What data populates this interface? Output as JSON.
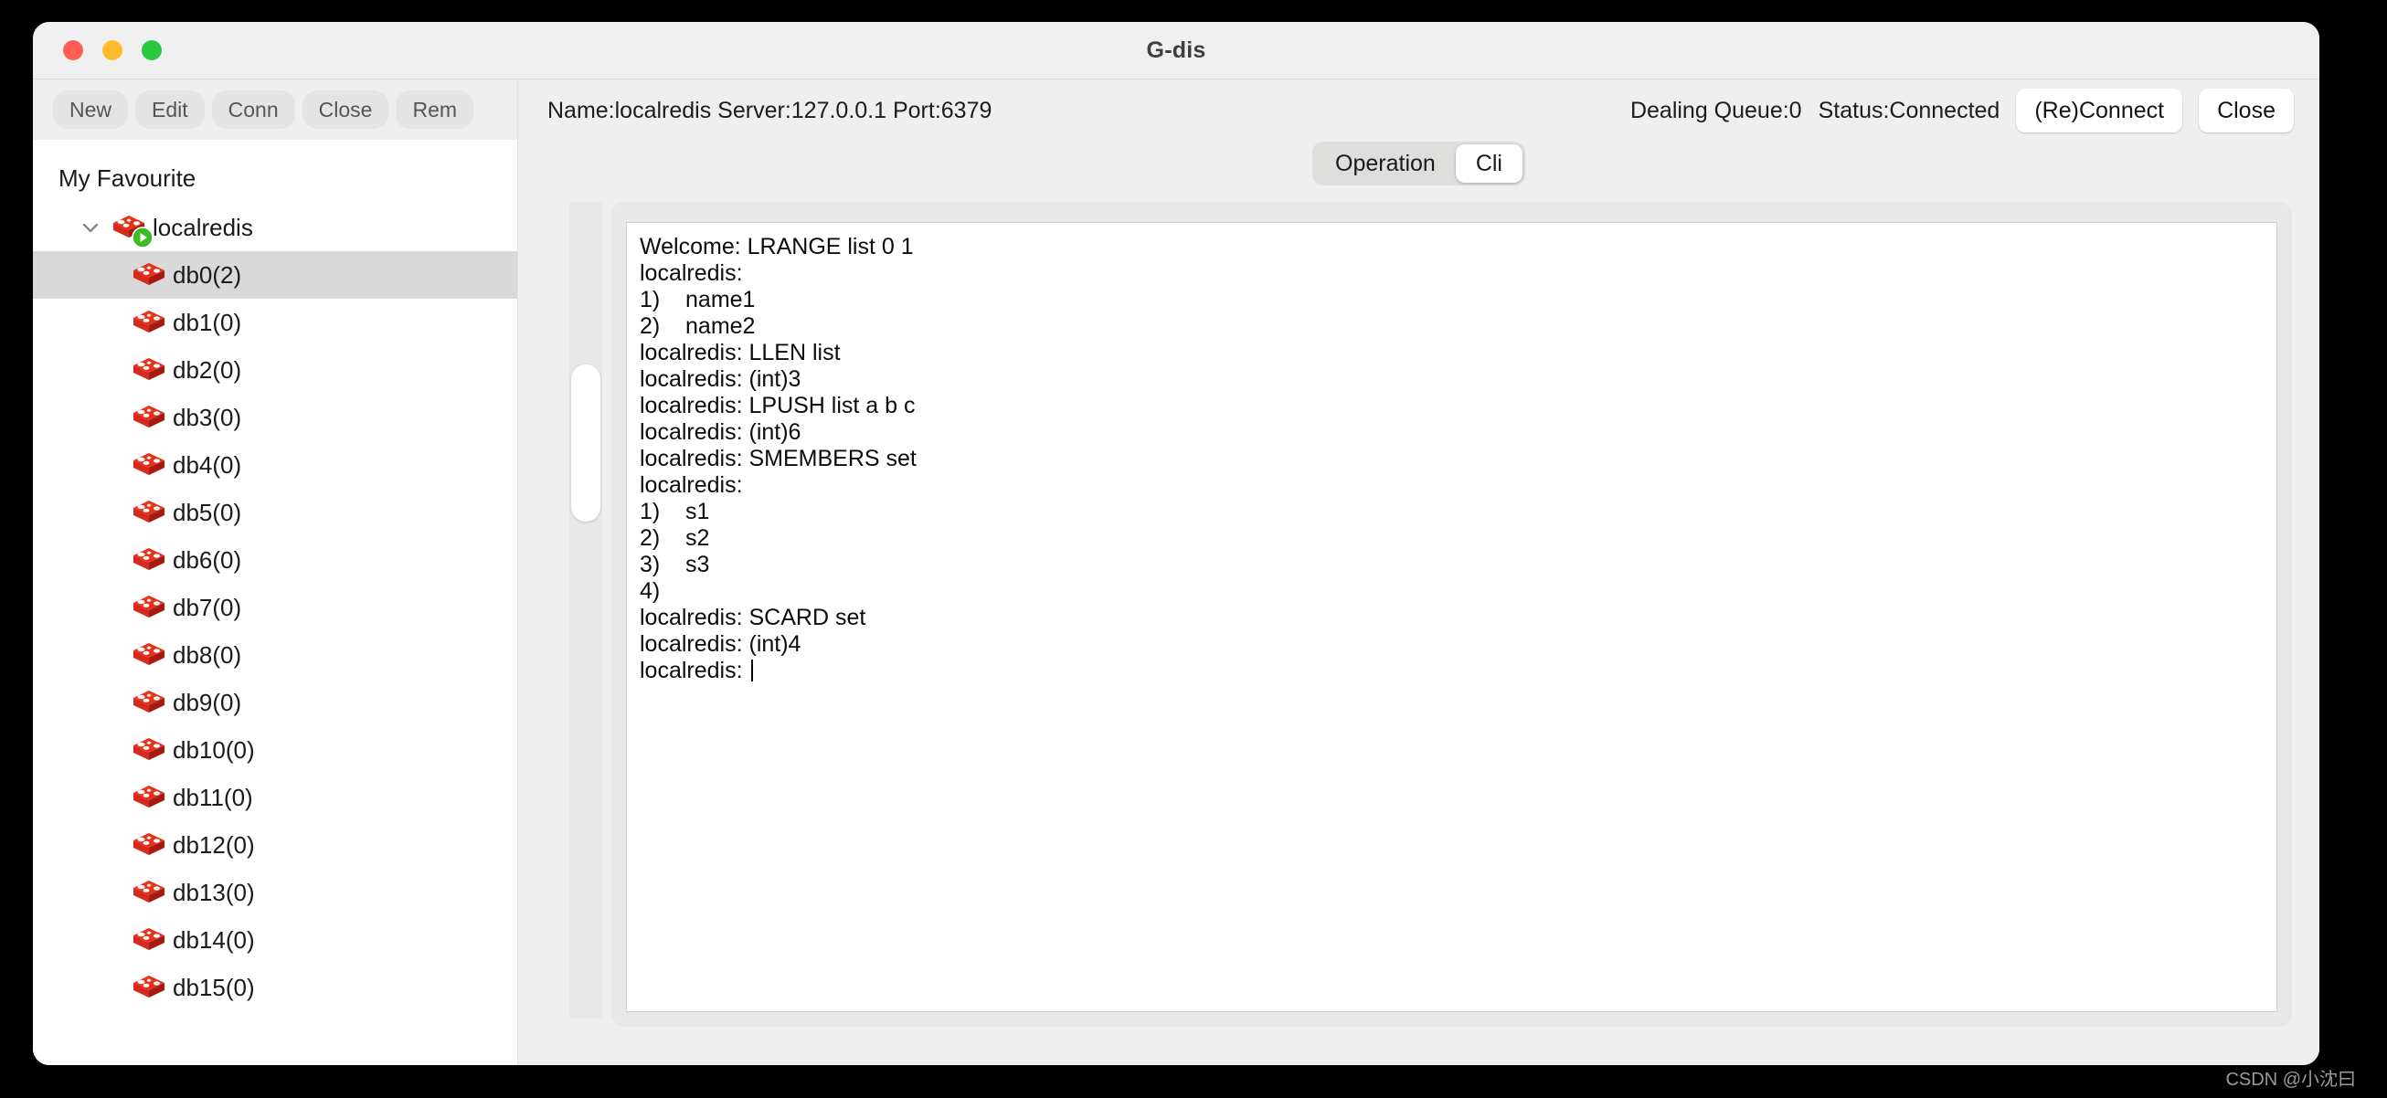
{
  "window": {
    "title": "G-dis",
    "traffic_lights": [
      {
        "name": "close",
        "color": "#ff5f57"
      },
      {
        "name": "minimize",
        "color": "#ffbd2e"
      },
      {
        "name": "maximize",
        "color": "#28c840"
      }
    ]
  },
  "left_toolbar": {
    "buttons": [
      {
        "label": "New"
      },
      {
        "label": "Edit"
      },
      {
        "label": "Conn"
      },
      {
        "label": "Close"
      },
      {
        "label": "Rem"
      }
    ]
  },
  "tree": {
    "root_label": "My Favourite",
    "connection": {
      "label": "localredis",
      "expanded": true,
      "chevron_icon": "chevron-down-icon",
      "icon": "redis-cube-icon",
      "badge_icon": "play-badge-icon"
    },
    "databases": [
      {
        "label": "db0(2)",
        "selected": true
      },
      {
        "label": "db1(0)",
        "selected": false
      },
      {
        "label": "db2(0)",
        "selected": false
      },
      {
        "label": "db3(0)",
        "selected": false
      },
      {
        "label": "db4(0)",
        "selected": false
      },
      {
        "label": "db5(0)",
        "selected": false
      },
      {
        "label": "db6(0)",
        "selected": false
      },
      {
        "label": "db7(0)",
        "selected": false
      },
      {
        "label": "db8(0)",
        "selected": false
      },
      {
        "label": "db9(0)",
        "selected": false
      },
      {
        "label": "db10(0)",
        "selected": false
      },
      {
        "label": "db11(0)",
        "selected": false
      },
      {
        "label": "db12(0)",
        "selected": false
      },
      {
        "label": "db13(0)",
        "selected": false
      },
      {
        "label": "db14(0)",
        "selected": false
      },
      {
        "label": "db15(0)",
        "selected": false
      }
    ]
  },
  "connection_header": {
    "info": "Name:localredis Server:127.0.0.1 Port:6379",
    "dealing_queue": "Dealing Queue:0",
    "status": "Status:Connected",
    "reconnect_label": "(Re)Connect",
    "close_label": "Close"
  },
  "tabs": {
    "items": [
      {
        "label": "Operation",
        "active": false
      },
      {
        "label": "Cli",
        "active": true
      }
    ]
  },
  "console": {
    "lines": [
      "Welcome: LRANGE list 0 1",
      "localredis:",
      "1)    name1",
      "2)    name2",
      "localredis: LLEN list",
      "localredis: (int)3",
      "localredis: LPUSH list a b c",
      "localredis: (int)6",
      "localredis: SMEMBERS set",
      "localredis:",
      "1)    s1",
      "2)    s2",
      "3)    s3",
      "4)",
      "localredis: SCARD set",
      "localredis: (int)4"
    ],
    "prompt": "localredis: "
  },
  "watermark": "CSDN @小沈曰",
  "colors": {
    "redis_red": "#d52b1e",
    "redis_red_light": "#f23a1d",
    "accent_green": "#3cbc27",
    "selection": "#d9d9d9",
    "window_bg": "#f0f0f0"
  }
}
